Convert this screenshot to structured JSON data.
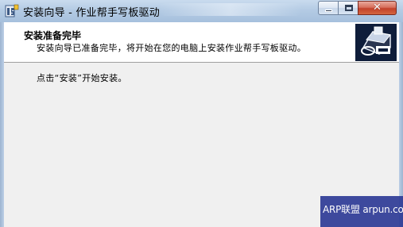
{
  "window": {
    "title": "安装向导 - 作业帮手写板驱动",
    "app_icon": "installer-icon",
    "close_glyph": "✕"
  },
  "header": {
    "title": "安装准备完毕",
    "subtitle": "安装向导已准备完毕，将开始在您的电脑上安装作业帮手写板驱动。",
    "icon": "installer-disk-icon"
  },
  "content": {
    "message": "点击“安装”开始安装。"
  },
  "watermark": {
    "text": "ARP联盟 arpun.com"
  },
  "colors": {
    "titlebar": "#b4cbe4",
    "header_bg": "#ffffff",
    "window_bg": "#f0f0f0",
    "close_button": "#c2412b",
    "watermark_bg": "#2e3b96"
  }
}
